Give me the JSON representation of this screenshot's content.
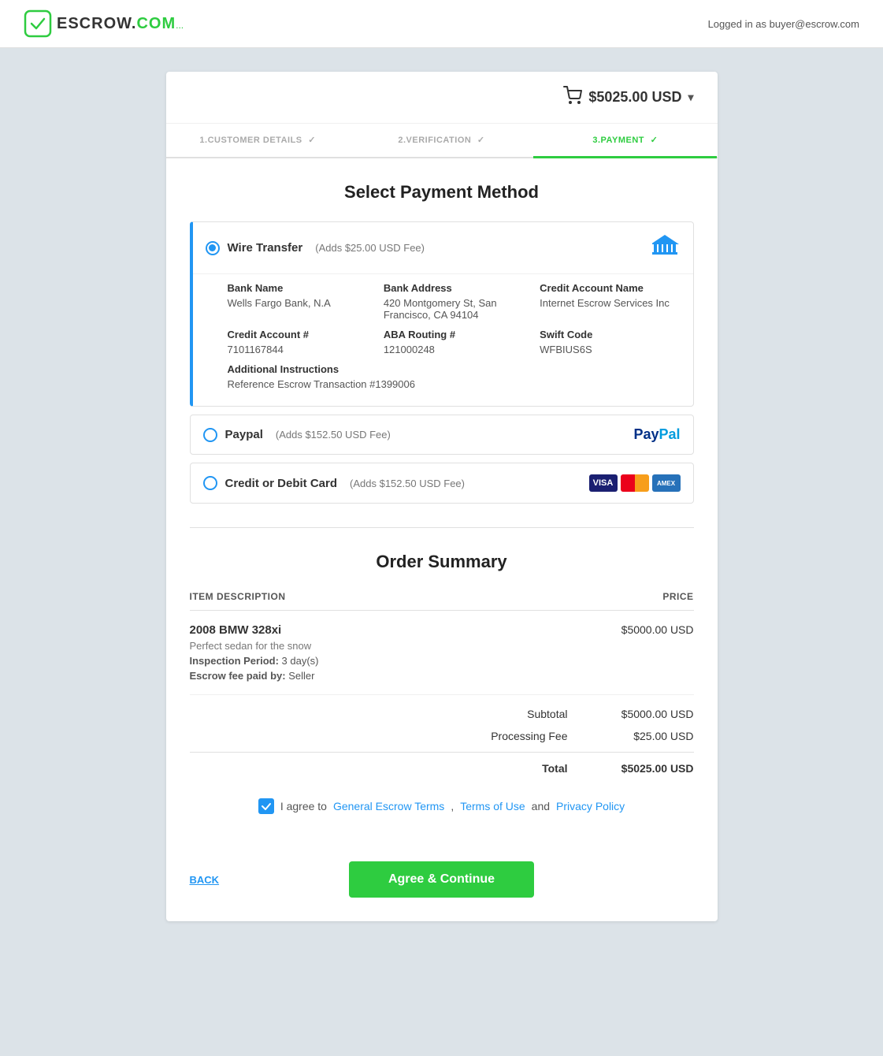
{
  "header": {
    "logo_text_dark": "ESCROW.",
    "logo_text_green": "COM",
    "logo_dots": "...",
    "logged_in_text": "Logged in as buyer@escrow.com"
  },
  "cart": {
    "amount": "$5025.00 USD",
    "icon": "cart-icon"
  },
  "steps": [
    {
      "label": "1.CUSTOMER DETAILS",
      "check": "✓",
      "active": false
    },
    {
      "label": "2.VERIFICATION",
      "check": "✓",
      "active": false
    },
    {
      "label": "3.PAYMENT",
      "check": "✓",
      "active": true
    }
  ],
  "select_payment": {
    "title": "Select Payment Method"
  },
  "payment_methods": [
    {
      "id": "wire",
      "label": "Wire Transfer",
      "fee": "(Adds $25.00 USD Fee)",
      "selected": true,
      "logo_type": "bank"
    },
    {
      "id": "paypal",
      "label": "Paypal",
      "fee": "(Adds $152.50 USD Fee)",
      "selected": false,
      "logo_type": "paypal"
    },
    {
      "id": "card",
      "label": "Credit or Debit Card",
      "fee": "(Adds $152.50 USD Fee)",
      "selected": false,
      "logo_type": "cards"
    }
  ],
  "wire_details": {
    "bank_name_label": "Bank Name",
    "bank_name_value": "Wells Fargo Bank, N.A",
    "bank_address_label": "Bank Address",
    "bank_address_value": "420 Montgomery St, San Francisco, CA 94104",
    "credit_account_name_label": "Credit Account Name",
    "credit_account_name_value": "Internet Escrow Services Inc",
    "credit_account_label": "Credit Account #",
    "credit_account_value": "7101167844",
    "aba_routing_label": "ABA Routing #",
    "aba_routing_value": "121000248",
    "swift_code_label": "Swift Code",
    "swift_code_value": "WFBIUS6S",
    "additional_instructions_label": "Additional Instructions",
    "additional_instructions_value": "Reference Escrow Transaction #1399006"
  },
  "order_summary": {
    "title": "Order Summary",
    "col_item": "ITEM DESCRIPTION",
    "col_price": "PRICE",
    "item_name": "2008 BMW 328xi",
    "item_price": "$5000.00 USD",
    "item_desc": "Perfect sedan for the snow",
    "inspection_label": "Inspection Period:",
    "inspection_value": "3 day(s)",
    "escrow_fee_label": "Escrow fee paid by:",
    "escrow_fee_value": "Seller",
    "subtotal_label": "Subtotal",
    "subtotal_value": "$5000.00 USD",
    "processing_fee_label": "Processing Fee",
    "processing_fee_value": "$25.00 USD",
    "total_label": "Total",
    "total_value": "$5025.00 USD"
  },
  "agreement": {
    "text_before": "I agree to ",
    "link1": "General Escrow Terms",
    "separator": ", ",
    "link2": "Terms of Use",
    "text_between": " and ",
    "link3": "Privacy Policy"
  },
  "buttons": {
    "back_label": "BACK",
    "continue_label": "Agree & Continue"
  }
}
